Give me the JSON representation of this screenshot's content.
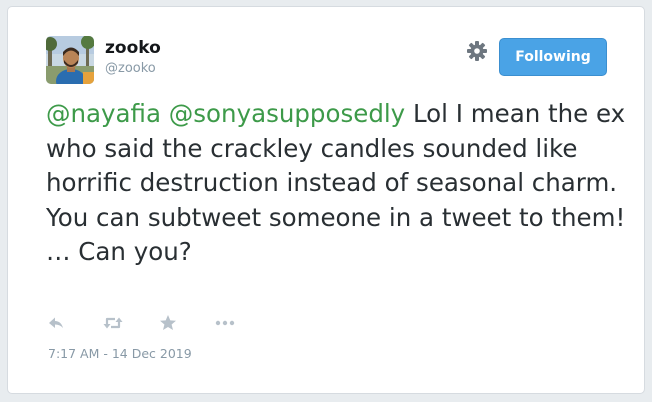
{
  "user": {
    "display_name": "zooko",
    "handle": "@zooko"
  },
  "follow_button": {
    "label": "Following"
  },
  "icons": {
    "settings": "gear-icon",
    "reply": "reply-icon",
    "retweet": "retweet-icon",
    "like": "star-icon",
    "more": "more-icon"
  },
  "tweet": {
    "mention_1": "@nayafia",
    "mention_2": "@sonyasupposedly",
    "body": " Lol I mean the ex who said the crackley candles sounded like horrific destruction instead of seasonal charm. You can subtweet someone in a tweet to them! … Can you?"
  },
  "timestamp": "7:17 AM - 14 Dec 2019",
  "colors": {
    "mention": "#3d9a49",
    "button": "#4aa3e6",
    "muted": "#8899a6",
    "text": "#292f33"
  }
}
